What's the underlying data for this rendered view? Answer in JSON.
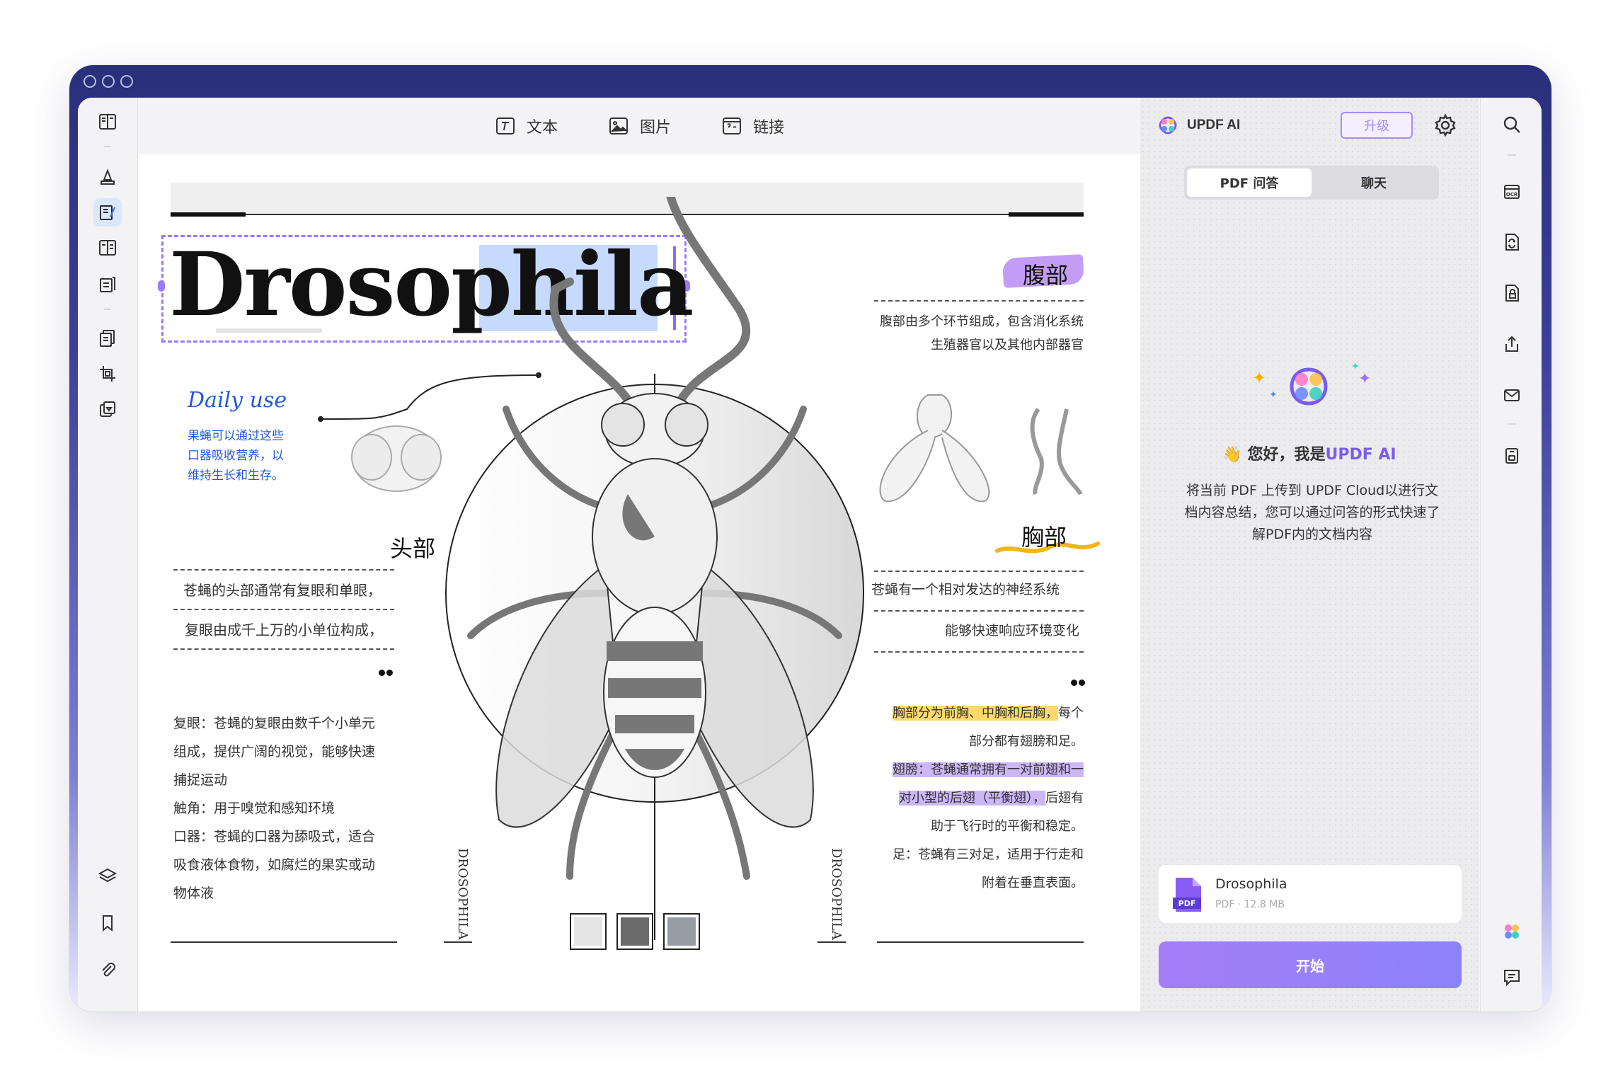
{
  "toolbar": {
    "text_label": "文本",
    "image_label": "图片",
    "link_label": "链接"
  },
  "document": {
    "title_plain": "Drosop",
    "title_selected": "hila",
    "daily_use": "Daily use",
    "daily_desc": [
      "果蝇可以通过这些",
      "口器吸收营养，以",
      "维持生长和生存。"
    ],
    "head": {
      "heading": "头部",
      "lines": [
        "苍蝇的头部通常有复眼和单眼，",
        "复眼由成千上万的小单位构成，"
      ],
      "detail": [
        "复眼：苍蝇的复眼由数千个小单元",
        "组成，提供广阔的视觉，能够快速",
        "捕捉运动",
        "触角：用于嗅觉和感知环境",
        "口器：苍蝇的口器为舔吸式，适合",
        "吸食液体食物，如腐烂的果实或动",
        "物体液"
      ]
    },
    "abdomen": {
      "heading": "腹部",
      "lines": [
        "腹部由多个环节组成，包含消化系统",
        "生殖器官以及其他内部器官"
      ]
    },
    "thorax": {
      "heading": "胸部",
      "lines": [
        "苍蝇有一个相对发达的神经系统",
        "能够快速响应环境变化"
      ],
      "detail_highlight1": "胸部分为前胸、中胸和后胸，",
      "detail_after1": "每个",
      "detail_line2": "部分都有翅膀和足。",
      "detail_highlight2a": "翅膀：苍蝇通常拥有一对前翅和一",
      "detail_highlight2b": "对小型的后翅（平衡翅），",
      "detail_after2": "后翅有",
      "detail_line5": "助于飞行时的平衡和稳定。",
      "detail_line6": "足：苍蝇有三对足，适用于行走和",
      "detail_line7": "附着在垂直表面。"
    },
    "vertical_label": "DROSOPHILA",
    "swatches": [
      "#e4e4e4",
      "#6b6b6b",
      "#979da2"
    ]
  },
  "ai": {
    "title": "UPDF AI",
    "upgrade": "升级",
    "tabs": [
      "PDF 问答",
      "聊天"
    ],
    "greeting_emoji": "👋",
    "greeting": "您好，我是",
    "greeting_brand": "UPDF AI",
    "description": "将当前 PDF 上传到 UPDF Cloud以进行文档内容总结，您可以通过问答的形式快速了解PDF内的文档内容",
    "file_name": "Drosophila",
    "file_meta": "PDF · 12.8 MB",
    "file_badge": "PDF",
    "start": "开始"
  },
  "colors": {
    "accent": "#8c6cf5",
    "selection": "#c6d9ff",
    "window": "#2f3384"
  },
  "icons": {
    "left_rail": [
      "reader-icon",
      "highlighter-icon",
      "edit-pdf-icon",
      "organize-icon",
      "form-icon",
      "page-icon",
      "crop-icon",
      "convert-icon",
      "layers-icon",
      "bookmark-icon",
      "attachment-icon"
    ],
    "right_rail": [
      "search-icon",
      "ocr-icon",
      "convert-icon",
      "protect-icon",
      "share-icon",
      "mail-icon",
      "save-icon",
      "updf-ai-icon",
      "comment-icon"
    ]
  }
}
